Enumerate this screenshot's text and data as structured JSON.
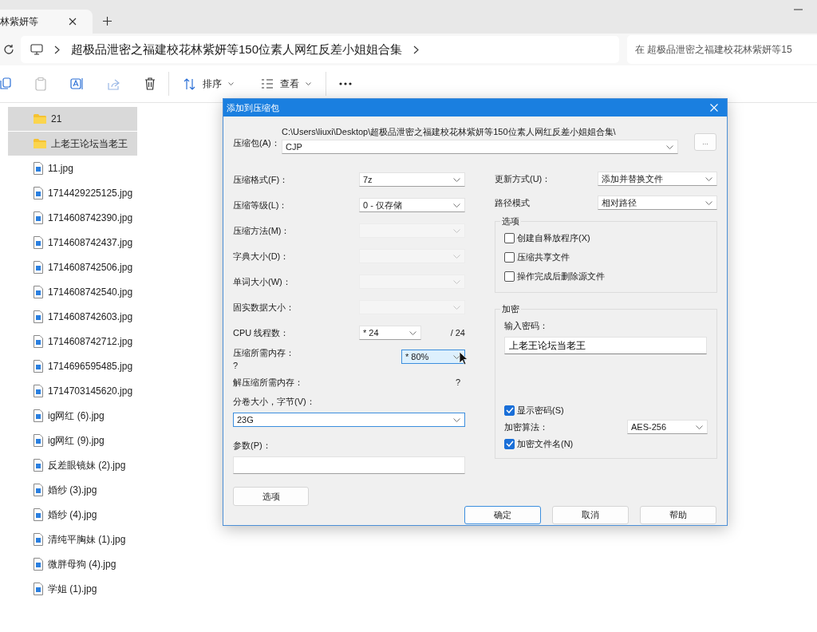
{
  "browser_tab": {
    "title": "林紫妍等"
  },
  "address_bar": {
    "path": "超极品泄密之福建校花林紫妍等150位素人网红反差小姐姐合集"
  },
  "search": {
    "placeholder": "在 超极品泄密之福建校花林紫妍等15"
  },
  "toolbar": {
    "sort": "排序",
    "view": "查看"
  },
  "files": [
    {
      "name": "21",
      "kind": "folder",
      "selected": true
    },
    {
      "name": "上老王论坛当老王",
      "kind": "folder",
      "selected": true
    },
    {
      "name": "11.jpg",
      "kind": "image",
      "selected": false
    },
    {
      "name": "1714429225125.jpg",
      "kind": "image",
      "selected": false
    },
    {
      "name": "1714608742390.jpg",
      "kind": "image",
      "selected": false
    },
    {
      "name": "1714608742437.jpg",
      "kind": "image",
      "selected": false
    },
    {
      "name": "1714608742506.jpg",
      "kind": "image",
      "selected": false
    },
    {
      "name": "1714608742540.jpg",
      "kind": "image",
      "selected": false
    },
    {
      "name": "1714608742603.jpg",
      "kind": "image",
      "selected": false
    },
    {
      "name": "1714608742712.jpg",
      "kind": "image",
      "selected": false
    },
    {
      "name": "1714696595485.jpg",
      "kind": "image",
      "selected": false
    },
    {
      "name": "1714703145620.jpg",
      "kind": "image",
      "selected": false
    },
    {
      "name": "ig网红 (6).jpg",
      "kind": "image",
      "selected": false
    },
    {
      "name": "ig网红 (9).jpg",
      "kind": "image",
      "selected": false
    },
    {
      "name": "反差眼镜妹 (2).jpg",
      "kind": "image",
      "selected": false
    },
    {
      "name": "婚纱 (3).jpg",
      "kind": "image",
      "selected": false
    },
    {
      "name": "婚纱 (4).jpg",
      "kind": "image",
      "selected": false
    },
    {
      "name": "清纯平胸妹 (1).jpg",
      "kind": "image",
      "selected": false
    },
    {
      "name": "微胖母狗 (4).jpg",
      "kind": "image",
      "selected": false
    },
    {
      "name": "学姐 (1).jpg",
      "kind": "image",
      "selected": false
    }
  ],
  "dialog": {
    "title": "添加到压缩包",
    "archive": {
      "label": "压缩包(A)：",
      "path": "C:\\Users\\liuxi\\Desktop\\超极品泄密之福建校花林紫妍等150位素人网红反差小姐姐合集\\",
      "value": "CJP",
      "browse": "..."
    },
    "left_fields": [
      {
        "label": "压缩格式(F)：",
        "value": "7z",
        "disabled": false
      },
      {
        "label": "压缩等级(L)：",
        "value": "0 - 仅存储",
        "disabled": false
      },
      {
        "label": "压缩方法(M)：",
        "disabled": true
      },
      {
        "label": "字典大小(D)：",
        "disabled": true
      },
      {
        "label": "单词大小(W)：",
        "disabled": true
      },
      {
        "label": "固实数据大小：",
        "disabled": true
      }
    ],
    "cpu_threads": {
      "label": "CPU 线程数：",
      "value": "* 24",
      "max": "/ 24"
    },
    "memory": {
      "label": "压缩所需内存：",
      "amount": "?",
      "value": "* 80%",
      "highlighted": true
    },
    "decompress_memory": {
      "label": "解压缩所需内存：",
      "amount": "?"
    },
    "volume_size": {
      "label": "分卷大小，字节(V)：",
      "value": "23G"
    },
    "parameters": {
      "label": "参数(P)："
    },
    "options_button": "选项",
    "right_fields": [
      {
        "label": "更新方式(U)：",
        "value": "添加并替换文件"
      },
      {
        "label": "路径模式",
        "value": "相对路径"
      }
    ],
    "options_group": {
      "title": "选项",
      "items": [
        {
          "label": "创建自释放程序(X)",
          "checked": false
        },
        {
          "label": "压缩共享文件",
          "checked": false
        },
        {
          "label": "操作完成后删除源文件",
          "checked": false
        }
      ]
    },
    "encryption": {
      "title": "加密",
      "password_label": "输入密码：",
      "password": "上老王论坛当老王",
      "show_password": {
        "label": "显示密码(S)",
        "checked": true
      },
      "method_label": "加密算法：",
      "method": "AES-256",
      "encrypt_names": {
        "label": "加密文件名(N)",
        "checked": true
      }
    },
    "buttons": [
      {
        "label": "确定",
        "default": true
      },
      {
        "label": "取消",
        "default": false
      },
      {
        "label": "帮助",
        "default": false
      }
    ]
  }
}
